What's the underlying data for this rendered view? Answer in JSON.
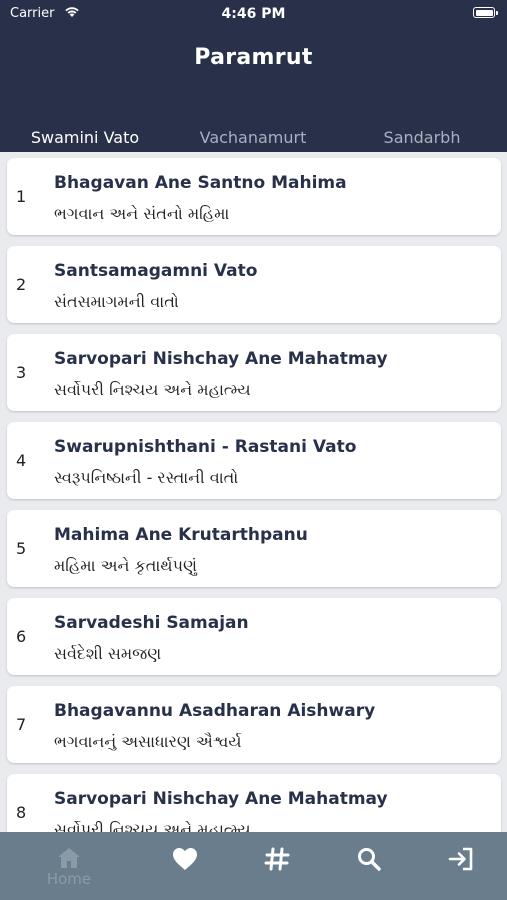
{
  "status_bar": {
    "carrier": "Carrier",
    "time": "4:46 PM"
  },
  "header": {
    "title": "Paramrut"
  },
  "tabs": [
    {
      "label": "Swamini Vato",
      "active": true
    },
    {
      "label": "Vachanamurt",
      "active": false
    },
    {
      "label": "Sandarbh",
      "active": false
    }
  ],
  "items": [
    {
      "number": "1",
      "title": "Bhagavan Ane Santno Mahima",
      "subtitle": "ભગવાન અને સંતનો મહિમા"
    },
    {
      "number": "2",
      "title": "Santsamagamni Vato",
      "subtitle": "સંતસમાગમની વાતો"
    },
    {
      "number": "3",
      "title": "Sarvopari Nishchay Ane Mahatmay",
      "subtitle": "સર્વોપરી નિશ્ચય અને મહાત્મ્ય"
    },
    {
      "number": "4",
      "title": "Swarupnishthani - Rastani Vato",
      "subtitle": "સ્વરૂપનિષ્ઠાની - રસ્તાની વાતો"
    },
    {
      "number": "5",
      "title": "Mahima Ane Krutarthpanu",
      "subtitle": "મહિમા અને કૃતાર્થપણું"
    },
    {
      "number": "6",
      "title": "Sarvadeshi Samajan",
      "subtitle": "સર્વદેશી સમજણ"
    },
    {
      "number": "7",
      "title": "Bhagavannu Asadharan Aishwary",
      "subtitle": "ભગવાનનું અસાધારણ ઐશ્વર્ય"
    },
    {
      "number": "8",
      "title": "Sarvopari Nishchay Ane Mahatmay",
      "subtitle": "સર્વોપરી નિશ્ચય અને મહાત્મ્ય"
    }
  ],
  "tabbar": {
    "home_label": "Home",
    "icons": [
      "home-icon",
      "heart-icon",
      "hashtag-icon",
      "search-icon",
      "logout-icon"
    ]
  },
  "colors": {
    "header_bg": "#283149",
    "tabbar_bg": "#697d8c",
    "list_bg": "#e9ebee"
  }
}
